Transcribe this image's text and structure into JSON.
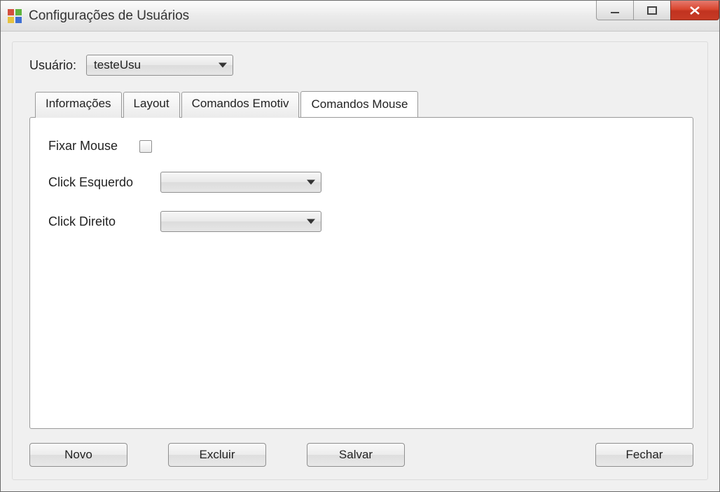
{
  "window": {
    "title": "Configurações de Usuários"
  },
  "user": {
    "label": "Usuário:",
    "selected": "testeUsu"
  },
  "tabs": {
    "info": "Informações",
    "layout": "Layout",
    "emotiv": "Comandos Emotiv",
    "mouse": "Comandos Mouse"
  },
  "mousePanel": {
    "fixar_label": "Fixar Mouse",
    "fixar_checked": false,
    "left_label": "Click Esquerdo",
    "left_value": "",
    "right_label": "Click Direito",
    "right_value": ""
  },
  "buttons": {
    "novo": "Novo",
    "excluir": "Excluir",
    "salvar": "Salvar",
    "fechar": "Fechar"
  }
}
